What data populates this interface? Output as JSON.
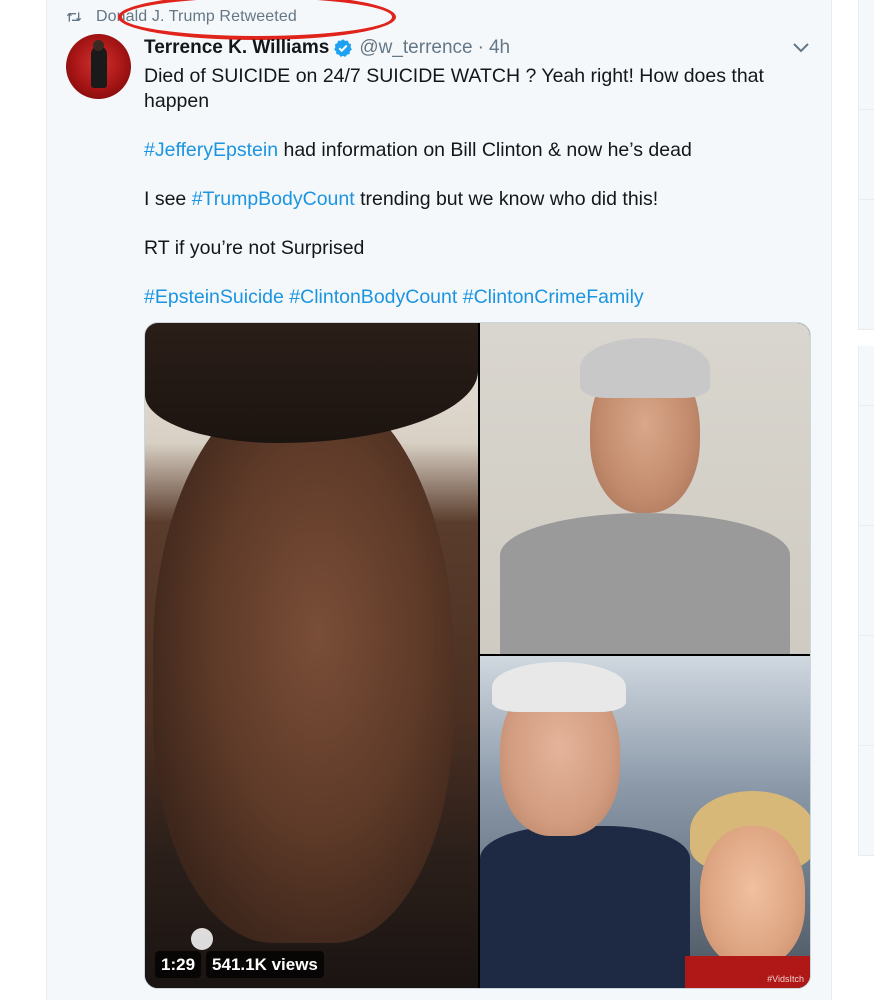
{
  "retweet": {
    "label": "Donald J. Trump Retweeted",
    "icon": "retweet-icon",
    "highlight_color": "#e0241b"
  },
  "author": {
    "display_name": "Terrence K. Williams",
    "handle": "@w_terrence",
    "separator": "·",
    "time": "4h",
    "verified": true
  },
  "tweet": {
    "line1": "Died of SUICIDE on 24/7 SUICIDE WATCH ? Yeah right! How does that happen",
    "line2_tag": "#JefferyEpstein",
    "line2_rest": " had information on Bill Clinton & now he’s dead",
    "line3_prefix": "I see ",
    "line3_tag": "#TrumpBodyCount",
    "line3_rest": " trending but we know who did this!",
    "line4": "RT if you’re not Surprised",
    "tags": [
      "#EpsteinSuicide",
      "#ClintonBodyCount",
      "#ClintonCrimeFamily"
    ]
  },
  "media": {
    "video_duration": "1:29",
    "view_count": "541.1K views",
    "watermark": "#VidsItch"
  },
  "colors": {
    "link": "#1b95e0",
    "muted": "#657786",
    "verified": "#1da1f2"
  }
}
